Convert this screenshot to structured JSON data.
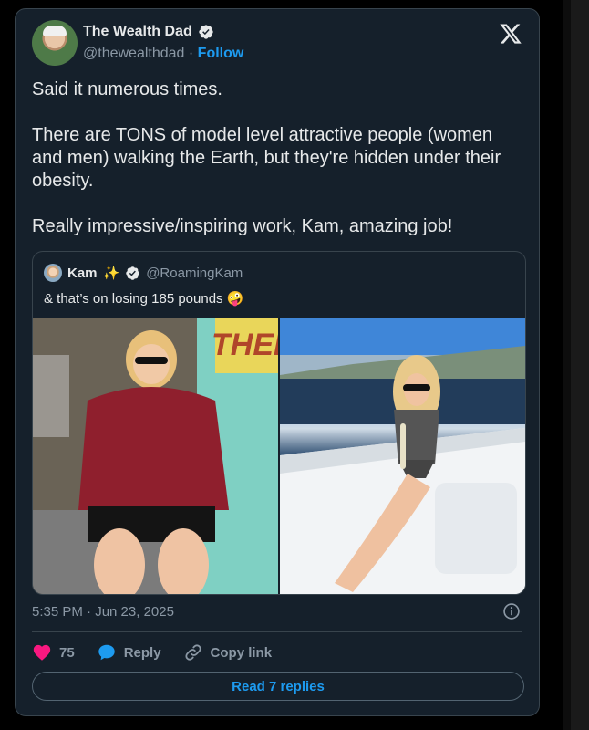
{
  "author": {
    "display_name": "The Wealth Dad",
    "handle": "@thewealthdad",
    "separator": "·",
    "follow_label": "Follow"
  },
  "tweet": {
    "text": "Said it numerous times.\n\nThere are TONS of model level attractive people (women and men) walking the Earth, but they're hidden under their obesity.\n\nReally impressive/inspiring work, Kam, amazing job!",
    "timestamp": "5:35 PM · Jun 23, 2025"
  },
  "quote": {
    "name": "Kam",
    "emoji": "✨",
    "handle": "@RoamingKam",
    "text": "& that’s on losing 185 pounds 🤪"
  },
  "actions": {
    "likes": "75",
    "reply_label": "Reply",
    "copy_link_label": "Copy link"
  },
  "read_replies_label": "Read 7 replies",
  "colors": {
    "background": "#15202b",
    "accent": "#1d9bf0",
    "heart": "#f91880"
  }
}
